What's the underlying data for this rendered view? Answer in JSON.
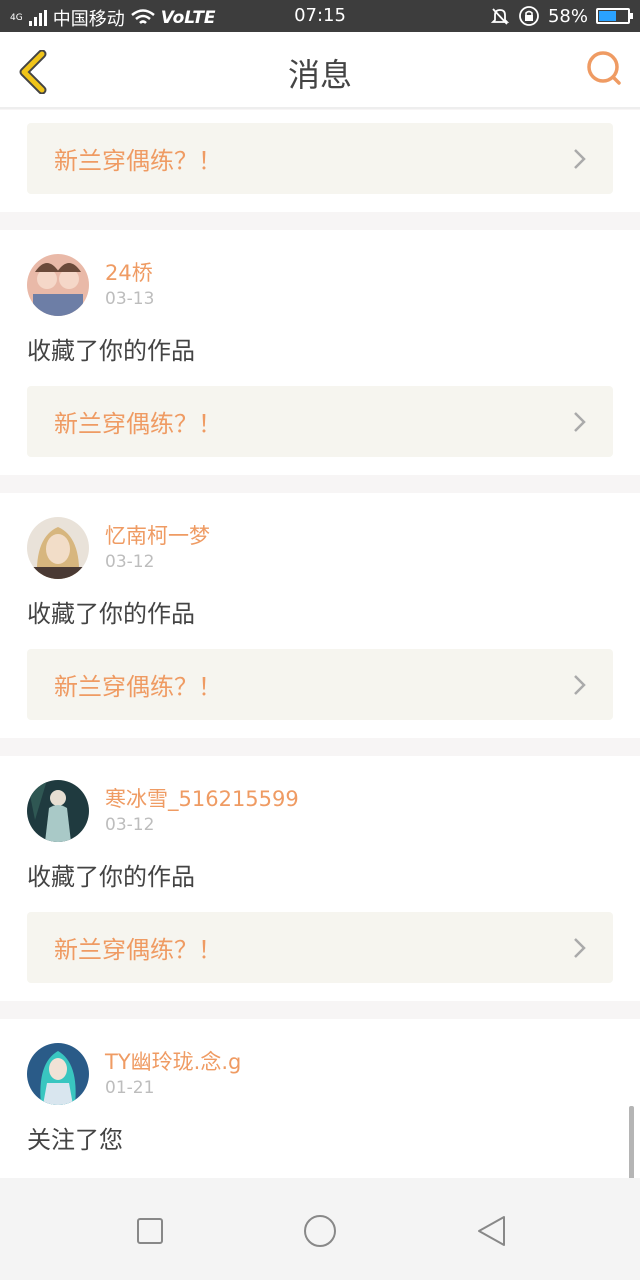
{
  "status_bar": {
    "network_gen": "4G",
    "carrier": "中国移动",
    "volte": "VoLTE",
    "time": "07:15",
    "battery_percent_text": "58%",
    "battery_level": 0.58
  },
  "header": {
    "title": "消息",
    "back_icon": "chevron-left-icon",
    "search_icon": "search-icon"
  },
  "messages": [
    {
      "work_title": "新兰穿偶练？！"
    },
    {
      "user": "24桥",
      "date": "03-13",
      "action": "收藏了你的作品",
      "work_title": "新兰穿偶练？！"
    },
    {
      "user": "忆南柯一梦",
      "date": "03-12",
      "action": "收藏了你的作品",
      "work_title": "新兰穿偶练？！"
    },
    {
      "user": "寒冰雪_516215599",
      "date": "03-12",
      "action": "收藏了你的作品",
      "work_title": "新兰穿偶练？！"
    },
    {
      "user": "TY幽玲珑.念.g",
      "date": "01-21",
      "action": "关注了您"
    }
  ],
  "colors": {
    "accent": "#ef9b63",
    "back_icon": "#f0c419",
    "status_bar": "#3d3d3d",
    "work_bg": "#f6f5ef"
  },
  "navbar": {
    "icons": [
      "square-recent-apps-icon",
      "circle-home-icon",
      "triangle-back-icon"
    ]
  }
}
